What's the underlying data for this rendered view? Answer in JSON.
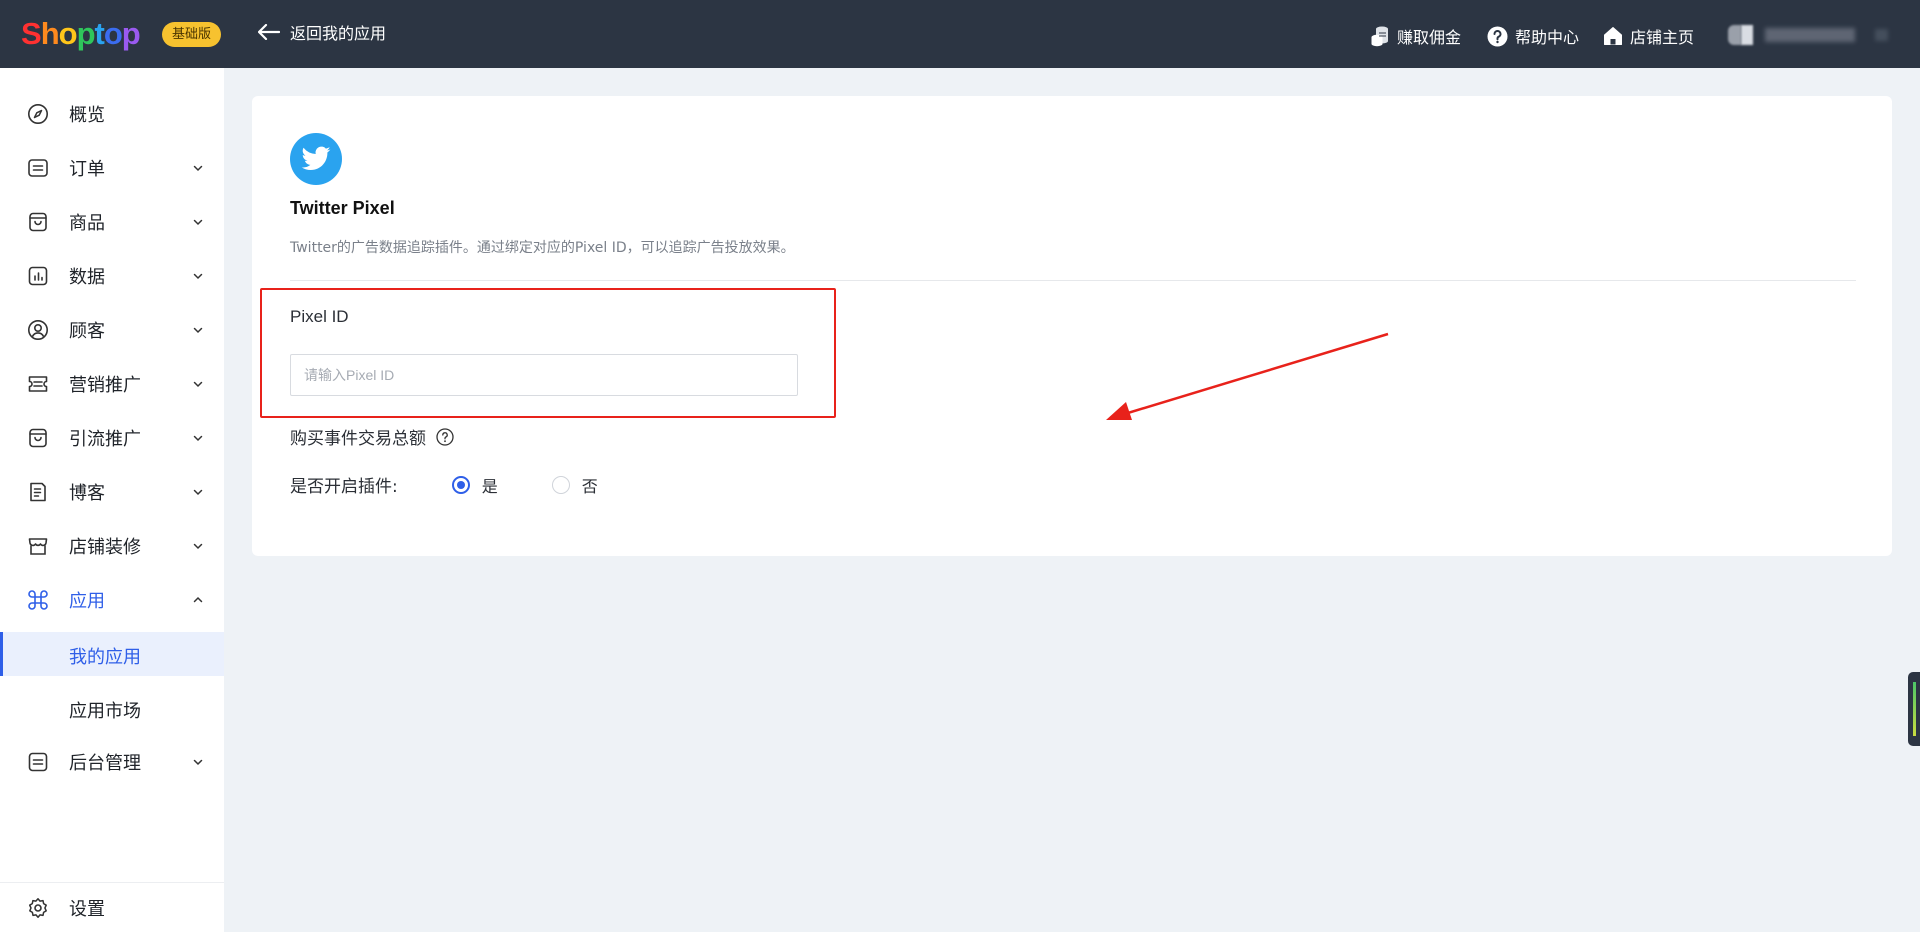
{
  "topbar": {
    "logo_letters": [
      "S",
      "h",
      "o",
      "p",
      "t",
      "o",
      "p"
    ],
    "logo_colors": [
      "#ff3131",
      "#ff8a1e",
      "#ffc61a",
      "#2fc65b",
      "#2aa3ef",
      "#3b6df0",
      "#9a5af0"
    ],
    "edition_badge": "基础版",
    "back_label": "返回我的应用",
    "earn_label": "赚取佣金",
    "help_label": "帮助中心",
    "store_label": "店铺主页"
  },
  "sidebar": {
    "items": [
      {
        "label": "概览",
        "icon": "compass-icon"
      },
      {
        "label": "订单",
        "icon": "order-icon"
      },
      {
        "label": "商品",
        "icon": "bag-icon"
      },
      {
        "label": "数据",
        "icon": "chart-icon"
      },
      {
        "label": "顾客",
        "icon": "user-icon"
      },
      {
        "label": "营销推广",
        "icon": "ticket-icon"
      },
      {
        "label": "引流推广",
        "icon": "bag-icon"
      },
      {
        "label": "博客",
        "icon": "document-icon"
      },
      {
        "label": "店铺装修",
        "icon": "shop-icon"
      },
      {
        "label": "应用",
        "icon": "command-icon"
      }
    ],
    "sub_items": [
      {
        "label": "我的应用"
      },
      {
        "label": "应用市场"
      }
    ],
    "admin_label": "后台管理",
    "settings_label": "设置"
  },
  "app": {
    "title": "Twitter Pixel",
    "description": "Twitter的广告数据追踪插件。通过绑定对应的Pixel ID，可以追踪广告投放效果。",
    "pixel_label": "Pixel ID",
    "pixel_placeholder": "请输入Pixel ID",
    "pixel_value": "",
    "event_label": "购买事件交易总额",
    "toggle_label": "是否开启插件:",
    "option_yes": "是",
    "option_no": "否",
    "selected": "是"
  },
  "colors": {
    "accent": "#2f5fe8",
    "topbar": "#2c3543",
    "annotation": "#e8221b",
    "twitter": "#2aa3ef"
  }
}
